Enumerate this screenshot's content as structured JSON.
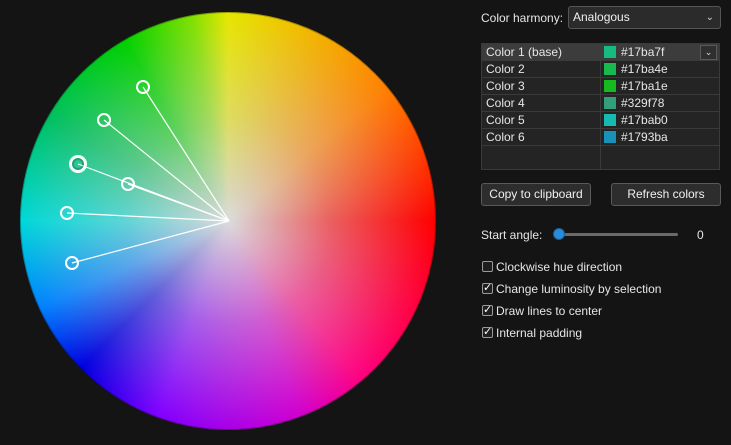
{
  "harmony": {
    "label": "Color harmony:",
    "value": "Analogous"
  },
  "colors": [
    {
      "name": "Color 1 (base)",
      "hex": "#17ba7f",
      "selected": true
    },
    {
      "name": "Color 2",
      "hex": "#17ba4e"
    },
    {
      "name": "Color 3",
      "hex": "#17ba1e"
    },
    {
      "name": "Color 4",
      "hex": "#329f78"
    },
    {
      "name": "Color 5",
      "hex": "#17bab0"
    },
    {
      "name": "Color 6",
      "hex": "#1793ba"
    }
  ],
  "buttons": {
    "copy": "Copy to clipboard",
    "refresh": "Refresh colors"
  },
  "start_angle": {
    "label": "Start angle:",
    "value": "0"
  },
  "options": [
    {
      "label": "Clockwise hue direction",
      "checked": false
    },
    {
      "label": "Change luminosity by selection",
      "checked": true
    },
    {
      "label": "Draw lines to center",
      "checked": true
    },
    {
      "label": "Internal padding",
      "checked": true
    }
  ],
  "icons": {
    "dropdown": "chevron-down-icon",
    "checkmark": "checkmark-icon"
  }
}
